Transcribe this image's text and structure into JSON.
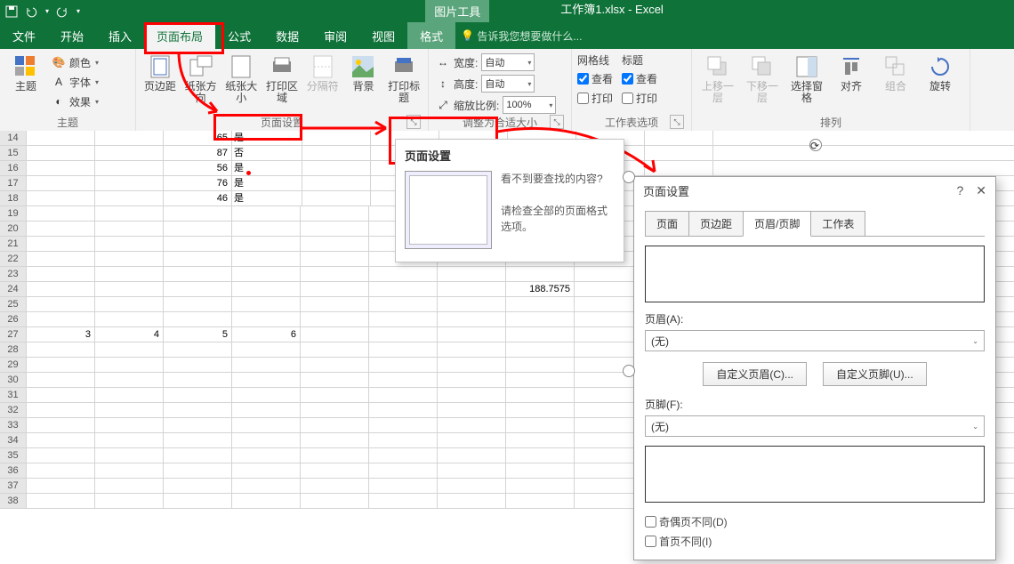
{
  "title": {
    "context": "图片工具",
    "doc": "工作簿1.xlsx - Excel"
  },
  "qat": {
    "save": "💾"
  },
  "tabs": {
    "file": "文件",
    "home": "开始",
    "insert": "插入",
    "layout": "页面布局",
    "formulas": "公式",
    "data": "数据",
    "review": "审阅",
    "view": "视图",
    "format": "格式",
    "tellme": "告诉我您想要做什么..."
  },
  "ribbon": {
    "theme": {
      "group": "主题",
      "themes": "主题",
      "colors": "颜色",
      "fonts": "字体",
      "effects": "效果"
    },
    "pagesetup": {
      "group": "页面设置",
      "margins": "页边距",
      "orientation": "纸张方向",
      "size": "纸张大小",
      "printarea": "打印区域",
      "breaks": "分隔符",
      "background": "背景",
      "printtitles": "打印标题"
    },
    "scale": {
      "group": "调整为合适大小",
      "width": "宽度:",
      "height": "高度:",
      "scale": "缩放比例:",
      "auto": "自动",
      "pct": "100%"
    },
    "sheetopts": {
      "group": "工作表选项",
      "gridlines": "网格线",
      "headings": "标题",
      "view": "查看",
      "print": "打印"
    },
    "arrange": {
      "group": "排列",
      "forward": "上移一层",
      "backward": "下移一层",
      "selection": "选择窗格",
      "align": "对齐",
      "group2": "组合",
      "rotate": "旋转"
    }
  },
  "cells": {
    "r14": {
      "c": "65",
      "d": "是"
    },
    "r15": {
      "c": "87",
      "d": "否"
    },
    "r16": {
      "c": "56",
      "d": "是"
    },
    "r17": {
      "c": "76",
      "d": "是"
    },
    "r18": {
      "c": "46",
      "d": "是"
    },
    "r24": {
      "h": "188.7575"
    },
    "r27": {
      "a": "3",
      "b": "4",
      "c": "5",
      "d": "6"
    }
  },
  "rows": [
    "14",
    "15",
    "16",
    "17",
    "18",
    "19",
    "20",
    "21",
    "22",
    "23",
    "24",
    "25",
    "26",
    "27",
    "28",
    "29",
    "30",
    "31",
    "32",
    "33",
    "34",
    "35",
    "36",
    "37",
    "38"
  ],
  "tooltip": {
    "title": "页面设置",
    "q": "看不到要查找的内容?",
    "body": "请检查全部的页面格式选项。"
  },
  "dialog": {
    "title": "页面设置",
    "help": "?",
    "close": "✕",
    "tabs": {
      "page": "页面",
      "margins": "页边距",
      "hf": "页眉/页脚",
      "sheet": "工作表"
    },
    "header_lbl": "页眉(A):",
    "footer_lbl": "页脚(F):",
    "none": "(无)",
    "custH": "自定义页眉(C)...",
    "custF": "自定义页脚(U)...",
    "oddeven": "奇偶页不同(D)",
    "firstpage": "首页不同(I)"
  }
}
